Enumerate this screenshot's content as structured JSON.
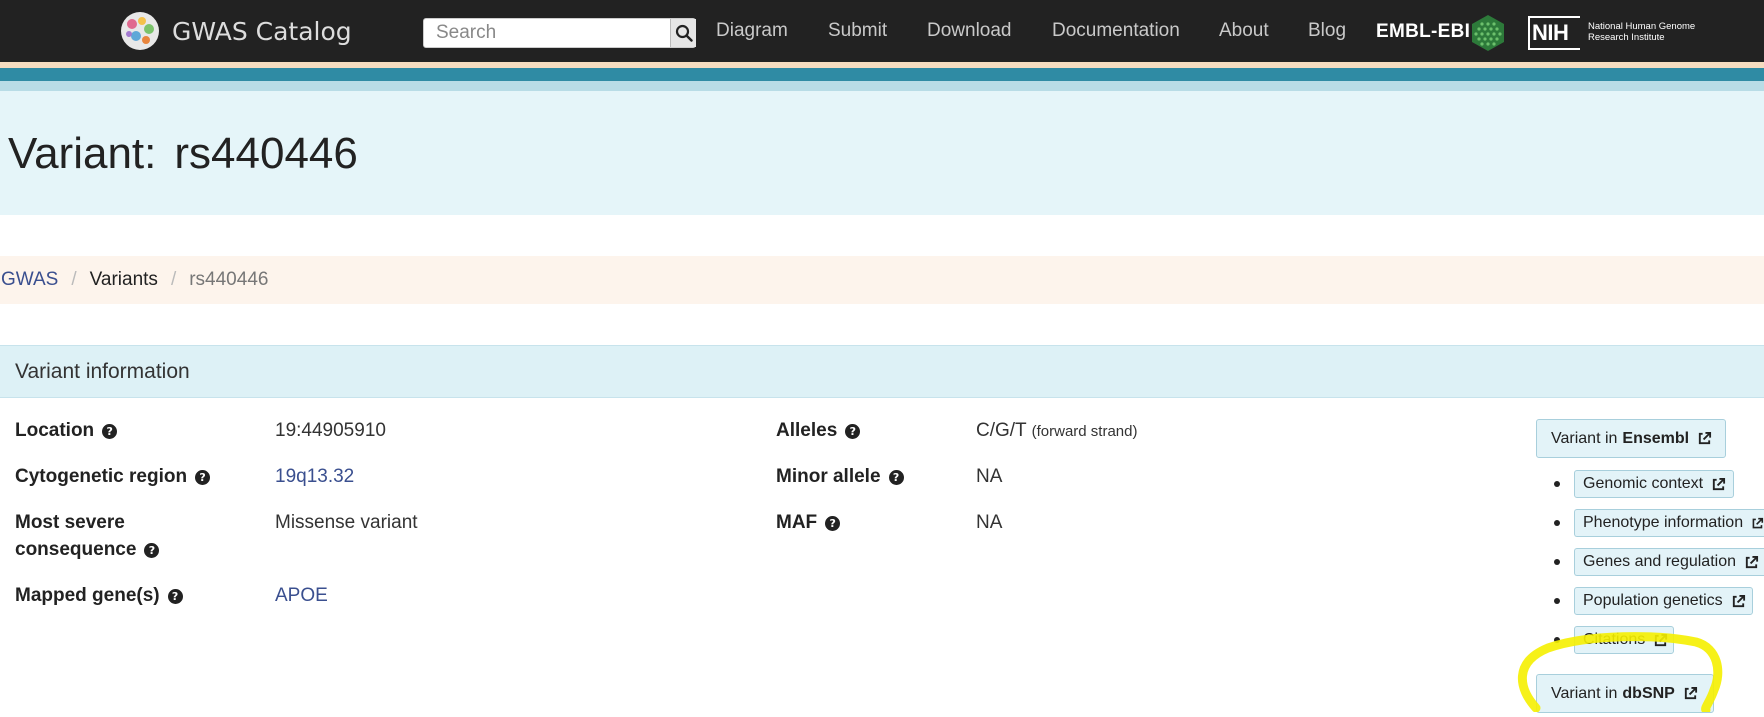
{
  "navbar": {
    "brand": "GWAS Catalog",
    "search_placeholder": "Search",
    "links": [
      "Diagram",
      "Submit",
      "Download",
      "Documentation",
      "About",
      "Blog"
    ],
    "ebi_label": "EMBL-EBI",
    "nih_label": "NIH",
    "nih_subtitle_line1": "National Human Genome",
    "nih_subtitle_line2": "Research Institute"
  },
  "page": {
    "title_prefix": "Variant:",
    "title_id": "rs440446"
  },
  "breadcrumb": {
    "root": "GWAS",
    "section": "Variants",
    "current": "rs440446"
  },
  "panel": {
    "title": "Variant information",
    "location_label": "Location",
    "location_value": "19:44905910",
    "cytogenetic_label": "Cytogenetic region",
    "cytogenetic_value": "19q13.32",
    "consequence_label_line1": "Most severe",
    "consequence_label_line2": "consequence",
    "consequence_value": "Missense variant",
    "mapped_genes_label": "Mapped gene(s)",
    "mapped_genes_value": "APOE",
    "alleles_label": "Alleles",
    "alleles_value": "C/G/T",
    "alleles_strand": "(forward strand)",
    "minor_allele_label": "Minor allele",
    "minor_allele_value": "NA",
    "maf_label": "MAF",
    "maf_value": "NA"
  },
  "external": {
    "ensembl_prefix": "Variant in",
    "ensembl_name": "Ensembl",
    "ensembl_links": [
      "Genomic context",
      "Phenotype information",
      "Genes and regulation",
      "Population genetics",
      "Citations"
    ],
    "dbsnp_prefix": "Variant in",
    "dbsnp_name": "dbSNP"
  },
  "colors": {
    "navbar_bg": "#222222",
    "title_band": "#e5f5f9",
    "link": "#3a4f8f",
    "highlight": "#f5f000"
  }
}
